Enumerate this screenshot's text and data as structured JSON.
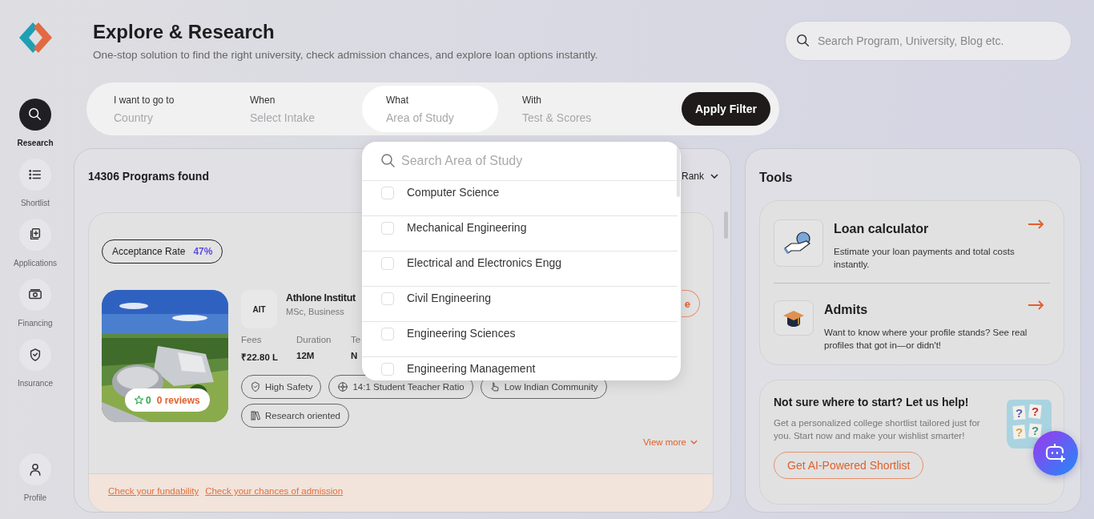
{
  "sidebar": {
    "items": [
      {
        "label": "Research",
        "selected": true
      },
      {
        "label": "Shortlist",
        "selected": false
      },
      {
        "label": "Applications",
        "selected": false
      },
      {
        "label": "Financing",
        "selected": false
      },
      {
        "label": "Insurance",
        "selected": false
      }
    ],
    "profile": {
      "label": "Profile"
    }
  },
  "header": {
    "title": "Explore & Research",
    "subtitle": "One-stop solution to find the right university, check admission chances, and explore loan options instantly.",
    "search": {
      "placeholder": "Search Program, University, Blog etc."
    }
  },
  "filter_bar": {
    "segments": [
      {
        "label": "I want to go to",
        "placeholder": "Country",
        "selected": false
      },
      {
        "label": "When",
        "placeholder": "Select Intake",
        "selected": false
      },
      {
        "label": "What",
        "placeholder": "Area of Study",
        "selected": true
      },
      {
        "label": "With",
        "placeholder": "Test & Scores",
        "selected": false
      }
    ],
    "apply_button": "Apply Filter"
  },
  "results": {
    "count": "14306 Programs found",
    "sort": "Rank",
    "program": {
      "acceptance": {
        "label": "Acceptance Rate",
        "value": "47%"
      },
      "rating": {
        "score": "0",
        "reviews": "0 reviews"
      },
      "logo_text": "AIT",
      "university": "Athlone Institut",
      "course": "MSc, Business",
      "stats": [
        {
          "label": "Fees",
          "value": "₹22.80 L"
        },
        {
          "label": "Duration",
          "value": "12M"
        },
        {
          "label": "Te",
          "value": "N"
        }
      ],
      "action_button": "e",
      "tags": [
        "High Safety",
        "14:1 Student Teacher Ratio",
        "Low Indian Community",
        "Research oriented"
      ],
      "view_more": "View more",
      "links": [
        "Check your fundability",
        "Check your chances of admission"
      ]
    }
  },
  "area_dropdown": {
    "placeholder": "Search Area of Study",
    "options": [
      {
        "label": "Computer Science",
        "checked": false
      },
      {
        "label": "Mechanical Engineering",
        "checked": false
      },
      {
        "label": "Electrical and Electronics Engg",
        "checked": false
      },
      {
        "label": "Civil Engineering",
        "checked": false
      },
      {
        "label": "Engineering Sciences",
        "checked": false
      },
      {
        "label": "Engineering Management",
        "checked": false
      }
    ]
  },
  "tools": {
    "title": "Tools",
    "items": [
      {
        "title": "Loan calculator",
        "description": "Estimate your loan payments and total costs instantly."
      },
      {
        "title": "Admits",
        "description": "Want to know where your profile stands? See real profiles that got in—or didn't!"
      }
    ],
    "help_card": {
      "title": "Not sure where to start? Let us help!",
      "description": "Get a personalized college shortlist tailored just for you. Start now and make your wishlist smarter!",
      "button": "Get AI-Powered Shortlist",
      "notes": [
        {
          "mark": "?",
          "color": "#5a5fb4"
        },
        {
          "mark": "?",
          "color": "#c0343c"
        },
        {
          "mark": "?",
          "color": "#e0a030"
        },
        {
          "mark": "?",
          "color": "#3f9a8c"
        }
      ]
    }
  }
}
